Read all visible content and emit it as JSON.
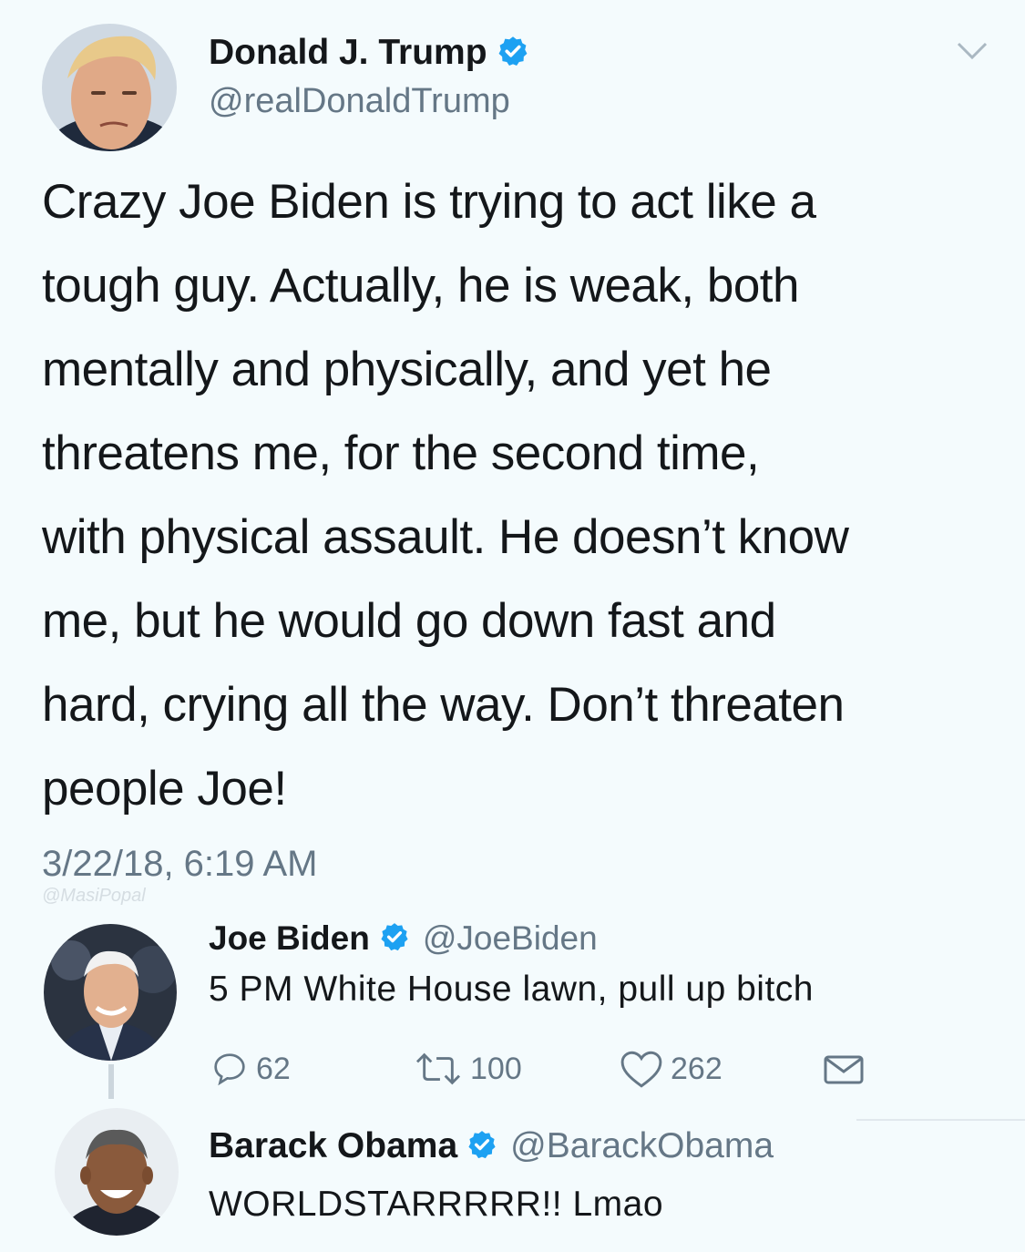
{
  "main_tweet": {
    "author_name": "Donald J. Trump",
    "handle": "@realDonaldTrump",
    "text": "Crazy Joe Biden is trying to act like a\ntough guy. Actually, he is weak, both\nmentally and physically, and yet he\nthreatens me, for the second time,\nwith physical assault. He doesn’t know\nme, but he would go down fast and\nhard, crying all the way. Don’t threaten\npeople Joe!",
    "timestamp": "3/22/18, 6:19 AM",
    "watermark": "@MasiPopal",
    "avatar_icon": "trump-avatar",
    "menu_icon": "chevron-down-icon"
  },
  "reply_1": {
    "author_name": "Joe Biden",
    "handle": "@JoeBiden",
    "text": "5 PM White House lawn, pull up bitch",
    "avatar_icon": "biden-avatar",
    "actions": {
      "replies": "62",
      "retweets": "100",
      "likes": "262"
    }
  },
  "reply_2": {
    "author_name": "Barack Obama",
    "handle": "@BarackObama",
    "text": "WORLDSTARRRRR!! Lmao",
    "avatar_icon": "obama-avatar"
  },
  "colors": {
    "background": "#f4fbfd",
    "verified_blue": "#1da1f2",
    "secondary_text": "#657786",
    "primary_text": "#14171a"
  }
}
